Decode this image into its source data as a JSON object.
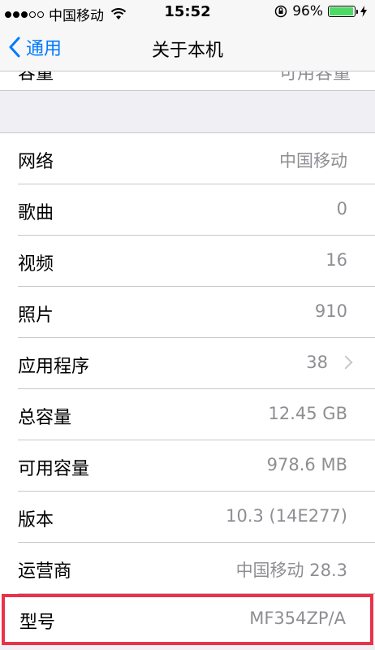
{
  "status_bar": {
    "carrier": "中国移动",
    "time": "15:52",
    "battery": "96%"
  },
  "nav": {
    "back_label": "通用",
    "title": "关于本机"
  },
  "rows": [
    {
      "label": "网络",
      "value": "中国移动"
    },
    {
      "label": "歌曲",
      "value": "0"
    },
    {
      "label": "视频",
      "value": "16"
    },
    {
      "label": "照片",
      "value": "910"
    },
    {
      "label": "应用程序",
      "value": "38"
    },
    {
      "label": "总容量",
      "value": "12.45 GB"
    },
    {
      "label": "可用容量",
      "value": "978.6 MB"
    },
    {
      "label": "版本",
      "value": "10.3 (14E277)"
    },
    {
      "label": "运营商",
      "value": "中国移动 28.3"
    },
    {
      "label": "型号",
      "value": "MF354ZP/A"
    }
  ],
  "colors": {
    "accent": "#007aff",
    "highlight": "#e8334a",
    "battery": "#4cd964"
  }
}
